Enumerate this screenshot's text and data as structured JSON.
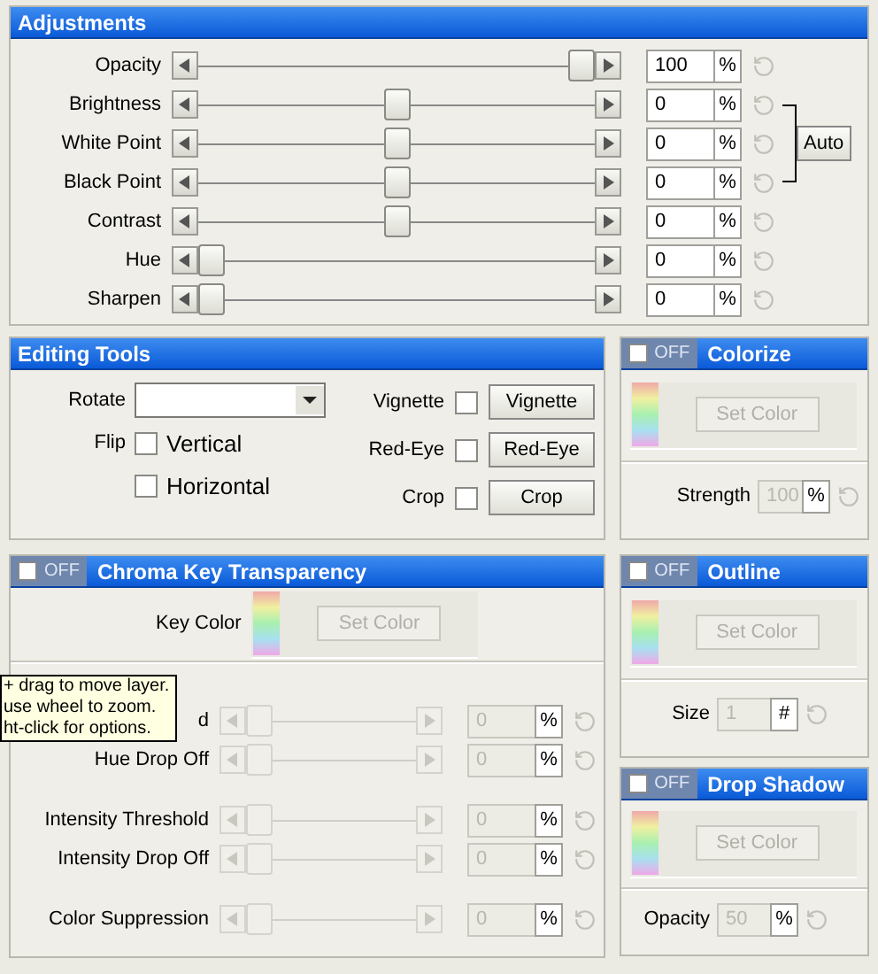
{
  "adjustments": {
    "title": "Adjustments",
    "auto_button": "Auto",
    "rows": [
      {
        "label": "Opacity",
        "level": 1,
        "value": "100",
        "unit": "%"
      },
      {
        "label": "Brightness",
        "level": 0.5,
        "value": "0",
        "unit": "%"
      },
      {
        "label": "White Point",
        "level": 0.5,
        "value": "0",
        "unit": "%"
      },
      {
        "label": "Black Point",
        "level": 0.5,
        "value": "0",
        "unit": "%"
      },
      {
        "label": "Contrast",
        "level": 0.5,
        "value": "0",
        "unit": "%"
      },
      {
        "label": "Hue",
        "level": 0,
        "value": "0",
        "unit": "%"
      },
      {
        "label": "Sharpen",
        "level": 0,
        "value": "0",
        "unit": "%"
      }
    ]
  },
  "editing_tools": {
    "title": "Editing Tools",
    "rotate_label": "Rotate",
    "flip_label": "Flip",
    "flip_options": [
      {
        "label": "Vertical",
        "checked": false
      },
      {
        "label": "Horizontal",
        "checked": false
      }
    ],
    "tools": [
      {
        "label": "Vignette",
        "checked": false,
        "button": "Vignette"
      },
      {
        "label": "Red-Eye",
        "checked": false,
        "button": "Red-Eye"
      },
      {
        "label": "Crop",
        "checked": false,
        "button": "Crop"
      }
    ]
  },
  "colorize": {
    "title": "Colorize",
    "toggle": "OFF",
    "on": false,
    "set_color": "Set Color",
    "strength_label": "Strength",
    "strength_value": "100",
    "strength_unit": "%"
  },
  "chroma_key": {
    "title": "Chroma Key Transparency",
    "toggle": "OFF",
    "on": false,
    "key_color_label": "Key Color",
    "set_color": "Set Color",
    "groups": [
      [
        {
          "label": "d",
          "level": 0,
          "value": "0",
          "unit": "%"
        },
        {
          "label": "Hue Drop Off",
          "level": 0,
          "value": "0",
          "unit": "%"
        }
      ],
      [
        {
          "label": "Intensity Threshold",
          "level": 0,
          "value": "0",
          "unit": "%"
        },
        {
          "label": "Intensity Drop Off",
          "level": 0,
          "value": "0",
          "unit": "%"
        }
      ],
      [
        {
          "label": "Color Suppression",
          "level": 0,
          "value": "0",
          "unit": "%"
        }
      ]
    ]
  },
  "outline": {
    "title": "Outline",
    "toggle": "OFF",
    "on": false,
    "set_color": "Set Color",
    "size_label": "Size",
    "size_value": "1",
    "size_unit": "#"
  },
  "drop_shadow": {
    "title": "Drop Shadow",
    "toggle": "OFF",
    "on": false,
    "set_color": "Set Color",
    "opacity_label": "Opacity",
    "opacity_value": "50",
    "opacity_unit": "%"
  },
  "tooltip": "+ drag to move layer.\nuse wheel to zoom.\nht-click for options."
}
